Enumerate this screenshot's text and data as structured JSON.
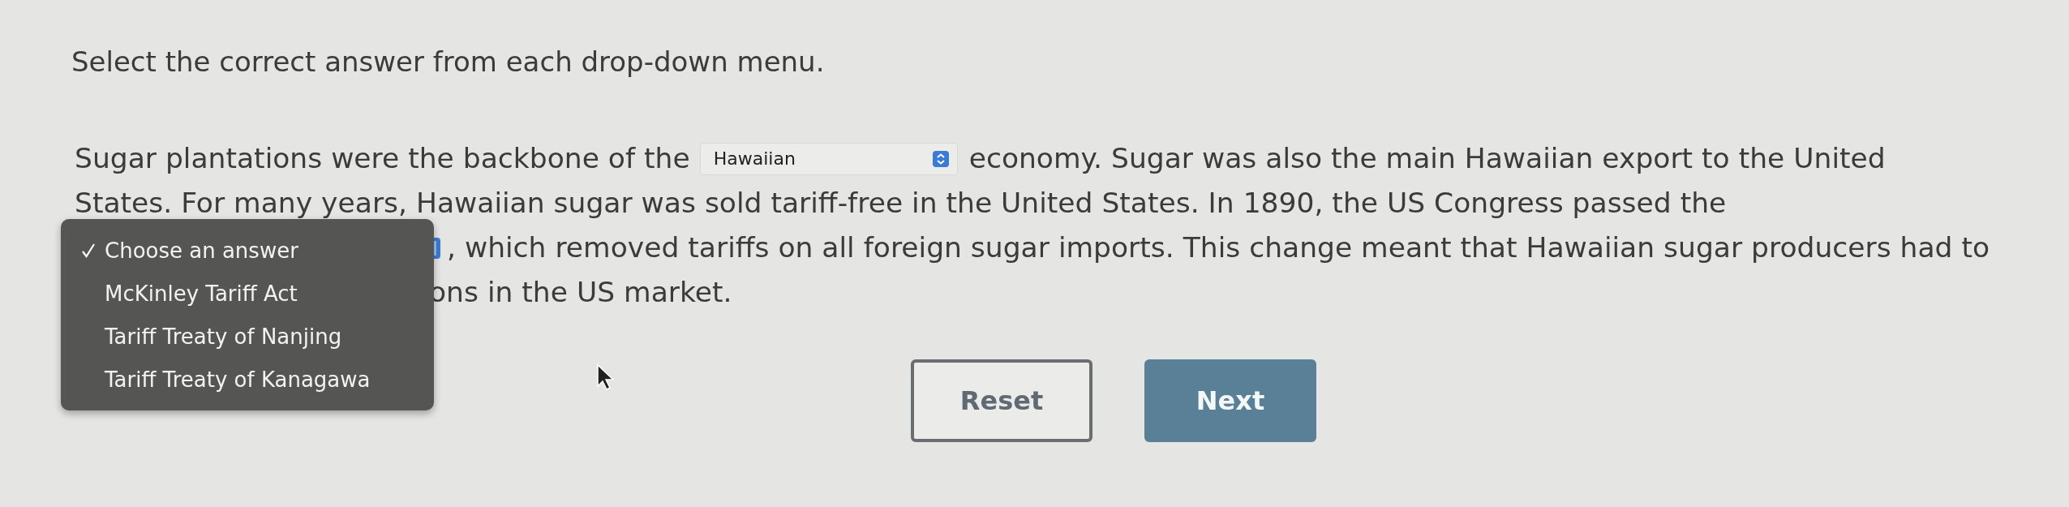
{
  "instruction": "Select the correct answer from each drop-down menu.",
  "passage": {
    "line_1_before": "Sugar plantations were the backbone of the",
    "dropdown_1": {
      "value": "Hawaiian"
    },
    "line_1_after": "economy. Sugar was also the main Hawaiian export to the United",
    "line_2": "States. For many years, Hawaiian sugar was sold tariff-free in the United States. In 1890, the US Congress passed the",
    "line_3_after": ", which removed tariffs on all foreign sugar imports. This change meant that Hawaiian sugar producers had to",
    "line_4": "ons in the US market."
  },
  "open_menu": {
    "options": [
      {
        "label": "Choose an answer",
        "selected": true
      },
      {
        "label": "McKinley Tariff Act",
        "selected": false
      },
      {
        "label": "Tariff Treaty of Nanjing",
        "selected": false
      },
      {
        "label": "Tariff Treaty of Kanagawa",
        "selected": false
      }
    ]
  },
  "buttons": [
    {
      "label": "Reset",
      "kind": "secondary"
    },
    {
      "label": "Next",
      "kind": "primary"
    }
  ]
}
